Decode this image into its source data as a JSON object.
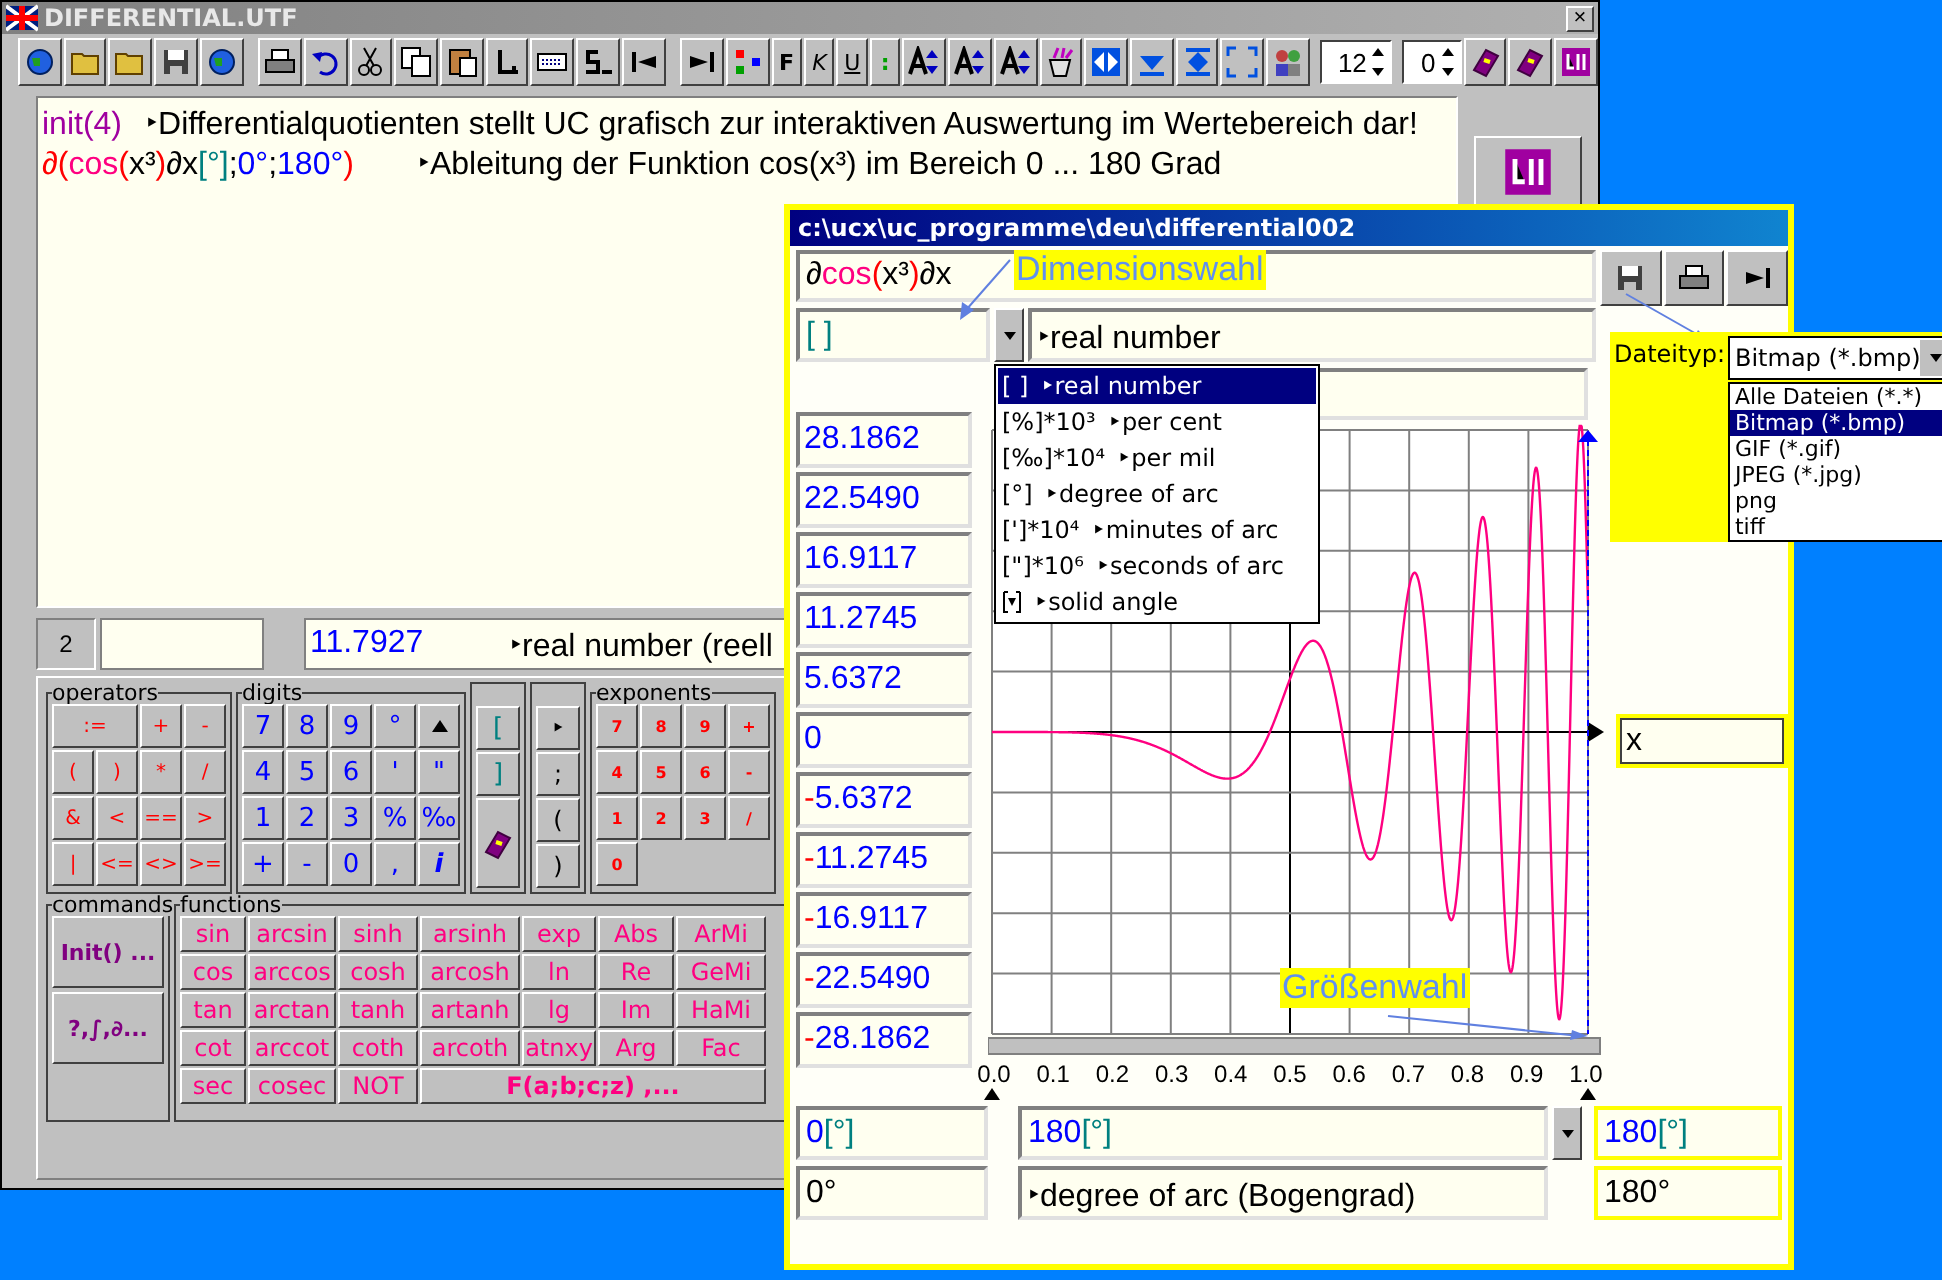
{
  "main_window": {
    "title": "DIFFERENTIAL.UTF",
    "close": "×"
  },
  "toolbar": {
    "format_buttons": [
      "F",
      "K",
      "U",
      ":"
    ],
    "font_size": "12",
    "spacing": "0"
  },
  "editor": {
    "lines": [
      {
        "code": [
          {
            "text": "init(4)",
            "color": "#a000a0"
          }
        ],
        "comment": "‣Differentialquotienten stellt UC grafisch zur interaktiven Auswertung im Wertebereich dar!"
      },
      {
        "code": [
          {
            "text": "∂(",
            "color": "#ff0000"
          },
          {
            "text": "cos",
            "color": "#ff0080"
          },
          {
            "text": "(",
            "color": "#ff0000"
          },
          {
            "text": "x³",
            "color": "#000000"
          },
          {
            "text": ")",
            "color": "#ff0000"
          },
          {
            "text": "∂x",
            "color": "#000000"
          },
          {
            "text": "[°]",
            "color": "#008080"
          },
          {
            "text": ";",
            "color": "#000000"
          },
          {
            "text": "0°",
            "color": "#0000ff"
          },
          {
            "text": ";",
            "color": "#000000"
          },
          {
            "text": "180°",
            "color": "#0000ff"
          },
          {
            "text": ")",
            "color": "#ff0000"
          }
        ],
        "comment": "‣Ableitung der Funktion cos(x³)  im Bereich 0 ... 180 Grad"
      }
    ]
  },
  "status_row": {
    "index": "2",
    "result": "11.7927",
    "unit": "‣real number (reell"
  },
  "keypad": {
    "operators_title": "operators",
    "operators": [
      ":=",
      "+",
      "-",
      "(",
      ")",
      "*",
      "/",
      "&",
      "<",
      "==",
      ">",
      "|",
      "<=",
      "<>",
      ">="
    ],
    "digits_title": "digits",
    "digits": [
      "7",
      "8",
      "9",
      "°",
      "4",
      "5",
      "6",
      "'",
      "\"",
      "1",
      "2",
      "3",
      "%",
      "‰",
      "+",
      "-",
      "0",
      ",",
      "i"
    ],
    "brackets": [
      "[",
      "]"
    ],
    "separators": [
      "‣",
      ";",
      "(",
      ")"
    ],
    "exponents_title": "exponents",
    "exponents": [
      "7",
      "8",
      "9",
      "+",
      "4",
      "5",
      "6",
      "-",
      "1",
      "2",
      "3",
      "/",
      "0"
    ],
    "commands_title": "commands",
    "commands": [
      "Init() ...",
      "?,∫,∂..."
    ],
    "functions_title": "functions",
    "functions": [
      "sin",
      "arcsin",
      "sinh",
      "arsinh",
      "exp",
      "Abs",
      "ArMi",
      "cos",
      "arccos",
      "cosh",
      "arcosh",
      "ln",
      "Re",
      "GeMi",
      "tan",
      "arctan",
      "tanh",
      "artanh",
      "lg",
      "Im",
      "HaMi",
      "cot",
      "arccot",
      "coth",
      "arcoth",
      "atnxy",
      "Arg",
      "Fac",
      "sec",
      "cosec",
      "NOT",
      "F(a;b;c;z) ,..."
    ]
  },
  "plot_window": {
    "title": "c:\\ucx\\uc_programme\\deu\\differential002",
    "formula": [
      {
        "text": "∂",
        "color": "#000000"
      },
      {
        "text": "cos",
        "color": "#ff0080"
      },
      {
        "text": "(",
        "color": "#ff0000"
      },
      {
        "text": "x³",
        "color": "#000000"
      },
      {
        "text": ")",
        "color": "#ff0000"
      },
      {
        "text": "∂x",
        "color": "#000000"
      }
    ],
    "dimension": "[ ]",
    "dimension_name": "‣real number",
    "dimension_list": [
      {
        "unit": "[ ]",
        "name": "‣real number",
        "selected": true
      },
      {
        "unit": "[%]*10³",
        "name": "‣per cent",
        "selected": false
      },
      {
        "unit": "[‰]*10⁴",
        "name": "‣per mil",
        "selected": false
      },
      {
        "unit": "[°]",
        "name": "‣degree of arc",
        "selected": false
      },
      {
        "unit": "[']*10⁴",
        "name": "‣minutes of arc",
        "selected": false
      },
      {
        "unit": "[\"]*10⁶",
        "name": "‣seconds of arc",
        "selected": false
      },
      {
        "name": "‣solid angle",
        "selected": false
      }
    ],
    "callout_dimension": "Dimensionswahl",
    "callout_size": "Größenwahl",
    "y_values": [
      {
        "text": "28.1862"
      },
      {
        "text": "22.5490"
      },
      {
        "text": "16.9117"
      },
      {
        "text": "11.2745"
      },
      {
        "text": "5.6372"
      },
      {
        "text": "0"
      },
      {
        "sign": "-",
        "text": "5.6372"
      },
      {
        "sign": "-",
        "text": "11.2745"
      },
      {
        "sign": "-",
        "text": "16.9117"
      },
      {
        "sign": "-",
        "text": "22.5490"
      },
      {
        "sign": "-",
        "text": "28.1862"
      }
    ],
    "x_ticks": [
      "0.0",
      "0.1",
      "0.2",
      "0.3",
      "0.4",
      "0.5",
      "0.6",
      "0.7",
      "0.8",
      "0.9",
      "1.0"
    ],
    "variable": "x",
    "from": {
      "value": "0",
      "unit": "[°]"
    },
    "to": {
      "value": "180",
      "unit": "[°]"
    },
    "to_right": {
      "value": "180",
      "unit": "[°]"
    },
    "from_display": "0°",
    "unit_name": "‣degree of arc (Bogengrad)",
    "to_display": "180°"
  },
  "file_type": {
    "label": "Dateityp:",
    "value": "Bitmap (*.bmp)",
    "options": [
      {
        "label": "Alle Dateien (*.*)",
        "selected": false
      },
      {
        "label": "Bitmap (*.bmp)",
        "selected": true
      },
      {
        "label": "GIF (*.gif)",
        "selected": false
      },
      {
        "label": "JPEG (*.jpg)",
        "selected": false
      },
      {
        "label": "png",
        "selected": false
      },
      {
        "label": "tiff",
        "selected": false
      }
    ]
  }
}
